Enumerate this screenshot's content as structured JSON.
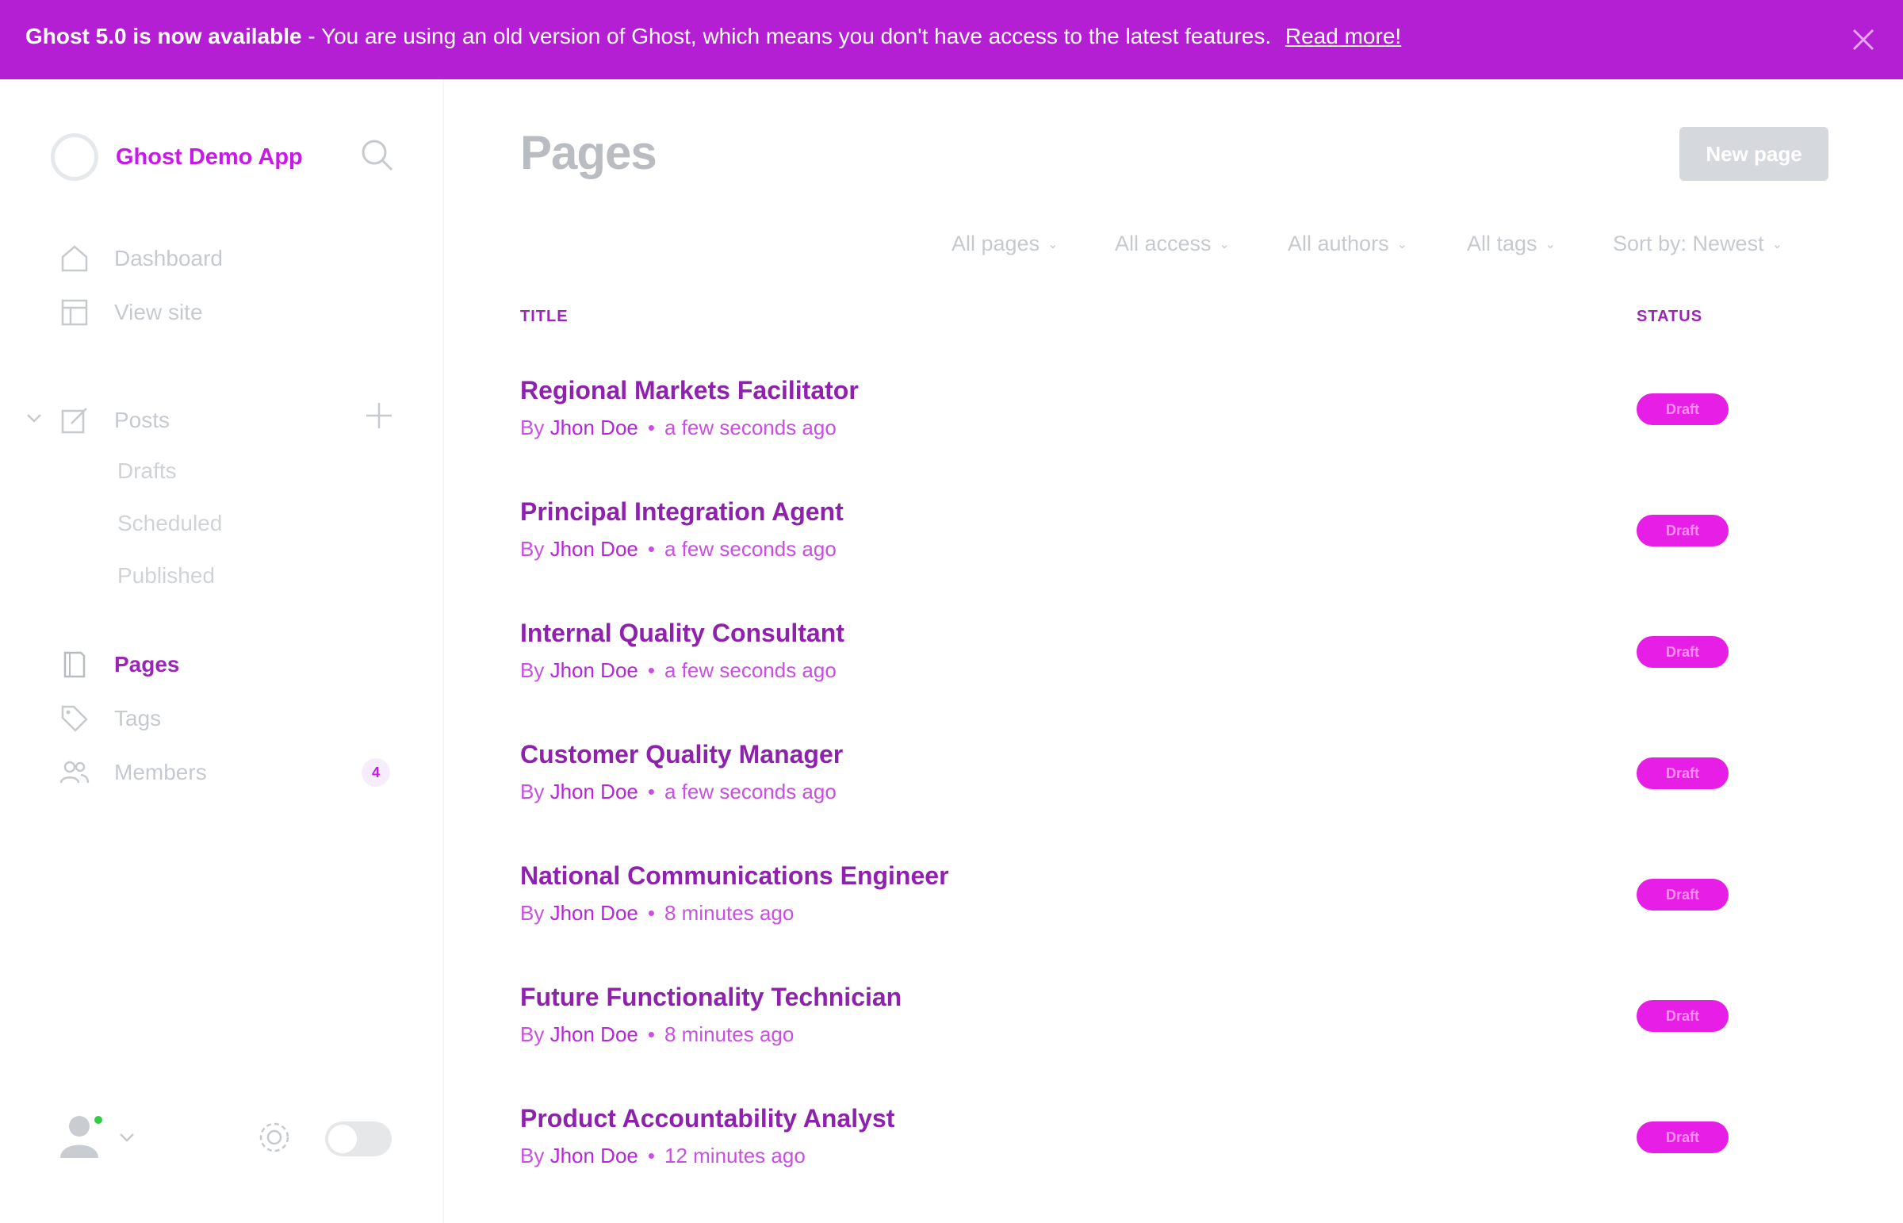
{
  "banner": {
    "lead": "Ghost 5.0 is now available",
    "message": "- You are using an old version of Ghost, which means you don't have access to the latest features.",
    "link": "Read more!"
  },
  "sidebar": {
    "site_name": "Ghost Demo App",
    "nav": [
      {
        "label": "Dashboard",
        "icon": "home-icon"
      },
      {
        "label": "View site",
        "icon": "layout-icon"
      },
      {
        "label": "Posts",
        "icon": "pencil-icon"
      },
      {
        "label": "Pages",
        "icon": "page-icon"
      },
      {
        "label": "Tags",
        "icon": "tag-icon"
      },
      {
        "label": "Members",
        "icon": "members-icon"
      }
    ],
    "posts_sub": [
      "Drafts",
      "Scheduled",
      "Published"
    ],
    "members_count": "4"
  },
  "main": {
    "title": "Pages",
    "new_button": "New page",
    "filters": [
      "All pages",
      "All access",
      "All authors",
      "All tags",
      "Sort by: Newest"
    ],
    "columns": {
      "title": "TITLE",
      "status": "STATUS"
    },
    "rows": [
      {
        "title": "Regional Markets Facilitator",
        "by": "By",
        "author": "Jhon Doe",
        "time": "a few seconds ago",
        "status": "Draft"
      },
      {
        "title": "Principal Integration Agent",
        "by": "By",
        "author": "Jhon Doe",
        "time": "a few seconds ago",
        "status": "Draft"
      },
      {
        "title": "Internal Quality Consultant",
        "by": "By",
        "author": "Jhon Doe",
        "time": "a few seconds ago",
        "status": "Draft"
      },
      {
        "title": "Customer Quality Manager",
        "by": "By",
        "author": "Jhon Doe",
        "time": "a few seconds ago",
        "status": "Draft"
      },
      {
        "title": "National Communications Engineer",
        "by": "By",
        "author": "Jhon Doe",
        "time": "8 minutes ago",
        "status": "Draft"
      },
      {
        "title": "Future Functionality Technician",
        "by": "By",
        "author": "Jhon Doe",
        "time": "8 minutes ago",
        "status": "Draft"
      },
      {
        "title": "Product Accountability Analyst",
        "by": "By",
        "author": "Jhon Doe",
        "time": "12 minutes ago",
        "status": "Draft"
      }
    ]
  },
  "colors": {
    "accent": "#c918e9",
    "banner_bg": "#b41fd4",
    "title_text": "#8e22ad",
    "status_badge": "#e61ee6",
    "muted_text": "#c6cace"
  }
}
